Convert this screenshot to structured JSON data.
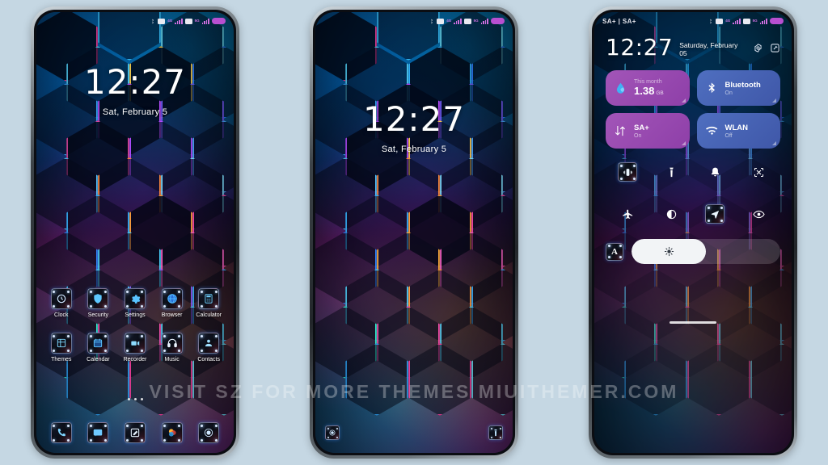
{
  "scene": {
    "background_color": "#c5d7e3",
    "watermark": "VISIT    SZ    FOR MORE THEMES    MIUITHEMER.COM"
  },
  "phones": [
    {
      "id": "phone-home",
      "screen_type": "home-screen",
      "status_bar": {
        "left": "",
        "icons": [
          "bluetooth-icon",
          "sim1-icon",
          "4g-label",
          "signal-icon",
          "sim2-icon",
          "5g-label",
          "signal-icon",
          "battery-icon"
        ],
        "labels": {
          "g1": "4G",
          "g2": "5G"
        }
      },
      "clock": {
        "time": "12:27",
        "date": "Sat, February 5"
      },
      "apps": [
        {
          "label": "Clock",
          "icon": "clock-icon"
        },
        {
          "label": "Security",
          "icon": "shield-icon"
        },
        {
          "label": "Settings",
          "icon": "gear-icon"
        },
        {
          "label": "Browser",
          "icon": "globe-icon"
        },
        {
          "label": "Calculator",
          "icon": "calculator-icon"
        },
        {
          "label": "Themes",
          "icon": "themes-icon"
        },
        {
          "label": "Calendar",
          "icon": "calendar-icon"
        },
        {
          "label": "Recorder",
          "icon": "recorder-icon"
        },
        {
          "label": "Music",
          "icon": "headphones-icon"
        },
        {
          "label": "Contacts",
          "icon": "contacts-icon"
        }
      ],
      "page_indicator": {
        "pages": 3,
        "active": 1
      },
      "dock": [
        {
          "label": "Phone",
          "icon": "phone-handset-icon"
        },
        {
          "label": "Messages",
          "icon": "messages-icon"
        },
        {
          "label": "Notes",
          "icon": "notes-pencil-icon"
        },
        {
          "label": "Gallery",
          "icon": "gallery-icon"
        },
        {
          "label": "Camera",
          "icon": "camera-lens-icon"
        }
      ]
    },
    {
      "id": "phone-lock",
      "screen_type": "lock-screen",
      "status_bar": {
        "left": "",
        "labels": {
          "g1": "4G",
          "g2": "5G"
        }
      },
      "clock": {
        "time": "12:27",
        "date": "Sat, February 5"
      },
      "shortcuts": [
        {
          "label": "Camera",
          "icon": "camera-lens-icon"
        },
        {
          "label": "Flashlight",
          "icon": "flashlight-icon"
        }
      ]
    },
    {
      "id": "phone-control-center",
      "screen_type": "notification-shade",
      "status_bar": {
        "left": "SA+ | SA+",
        "labels": {
          "g1": "4G",
          "g2": "5G"
        }
      },
      "header": {
        "time": "12:27",
        "date": "Saturday, February 05",
        "settings_icon": "gear-icon",
        "edit_icon": "edit-pencil-icon"
      },
      "tiles": [
        {
          "name": "data-usage",
          "kind": "data",
          "color": "#9a4bb0",
          "icon": "data-drop-icon",
          "small_text": "This month",
          "value": "1.38",
          "unit": "GB"
        },
        {
          "name": "bluetooth",
          "kind": "standard",
          "color": "#4a63b4",
          "icon": "bluetooth-icon",
          "title": "Bluetooth",
          "state": "On"
        },
        {
          "name": "mobile-data",
          "kind": "standard",
          "color": "#9a4bb0",
          "icon": "data-arrows-icon",
          "title": "SA+",
          "state": "On"
        },
        {
          "name": "wlan",
          "kind": "standard",
          "color": "#4a63b4",
          "icon": "wifi-icon",
          "title": "WLAN",
          "state": "Off"
        }
      ],
      "toggles": [
        {
          "name": "vibrate",
          "icon": "vibrate-icon",
          "themed": true
        },
        {
          "name": "flashlight",
          "icon": "flashlight-icon",
          "themed": false
        },
        {
          "name": "ring",
          "icon": "bell-icon",
          "themed": false
        },
        {
          "name": "screenshot",
          "icon": "screenshot-scissors-icon",
          "themed": false
        },
        {
          "name": "airplane-mode",
          "icon": "airplane-icon",
          "themed": false
        },
        {
          "name": "dark-mode",
          "icon": "contrast-circle-icon",
          "themed": false
        },
        {
          "name": "location",
          "icon": "location-arrow-icon",
          "themed": true
        },
        {
          "name": "reading-mode",
          "icon": "eye-icon",
          "themed": false
        }
      ],
      "brightness": {
        "auto_label": "A",
        "auto_icon": "auto-brightness-icon",
        "slider_icon": "sun-icon",
        "level_percent": 50
      }
    }
  ]
}
